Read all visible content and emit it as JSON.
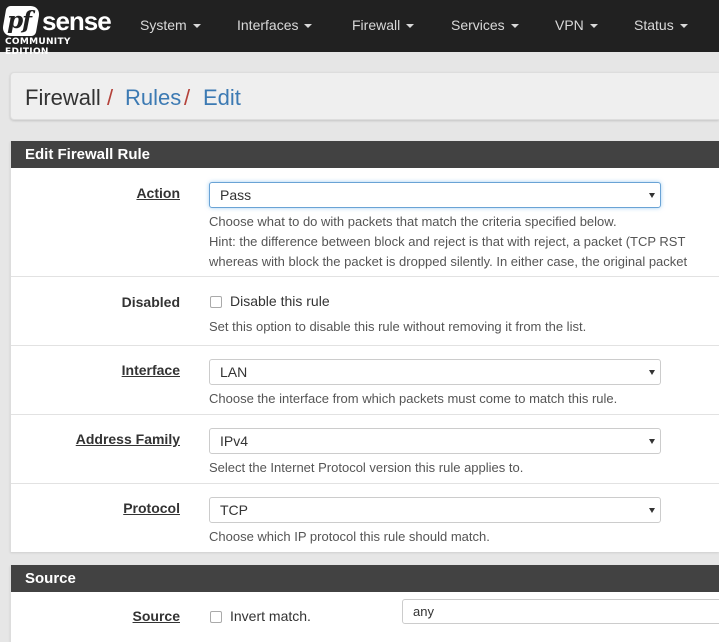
{
  "navbar": {
    "logo_pf": "pf",
    "logo_sense": "sense",
    "logo_edition": "COMMUNITY EDITION",
    "items": [
      {
        "label": "System"
      },
      {
        "label": "Interfaces"
      },
      {
        "label": "Firewall"
      },
      {
        "label": "Services"
      },
      {
        "label": "VPN"
      },
      {
        "label": "Status"
      }
    ]
  },
  "breadcrumb": {
    "root": "Firewall",
    "sep": "/",
    "level1": "Rules",
    "level2": "Edit"
  },
  "edit_panel": {
    "title": "Edit Firewall Rule",
    "action": {
      "label": "Action",
      "value": "Pass",
      "help1": "Choose what to do with packets that match the criteria specified below.",
      "help2": "Hint: the difference between block and reject is that with reject, a packet (TCP RST",
      "help3": "whereas with block the packet is dropped silently. In either case, the original packet"
    },
    "disabled": {
      "label": "Disabled",
      "checkbox_label": "Disable this rule",
      "checked": false,
      "help": "Set this option to disable this rule without removing it from the list."
    },
    "interface": {
      "label": "Interface",
      "value": "LAN",
      "help": "Choose the interface from which packets must come to match this rule."
    },
    "address_family": {
      "label": "Address Family",
      "value": "IPv4",
      "help": "Select the Internet Protocol version this rule applies to."
    },
    "protocol": {
      "label": "Protocol",
      "value": "TCP",
      "help": "Choose which IP protocol this rule should match."
    }
  },
  "source_panel": {
    "title": "Source",
    "source": {
      "label": "Source",
      "invert_label": "Invert match.",
      "invert_checked": false,
      "value": "any"
    }
  }
}
